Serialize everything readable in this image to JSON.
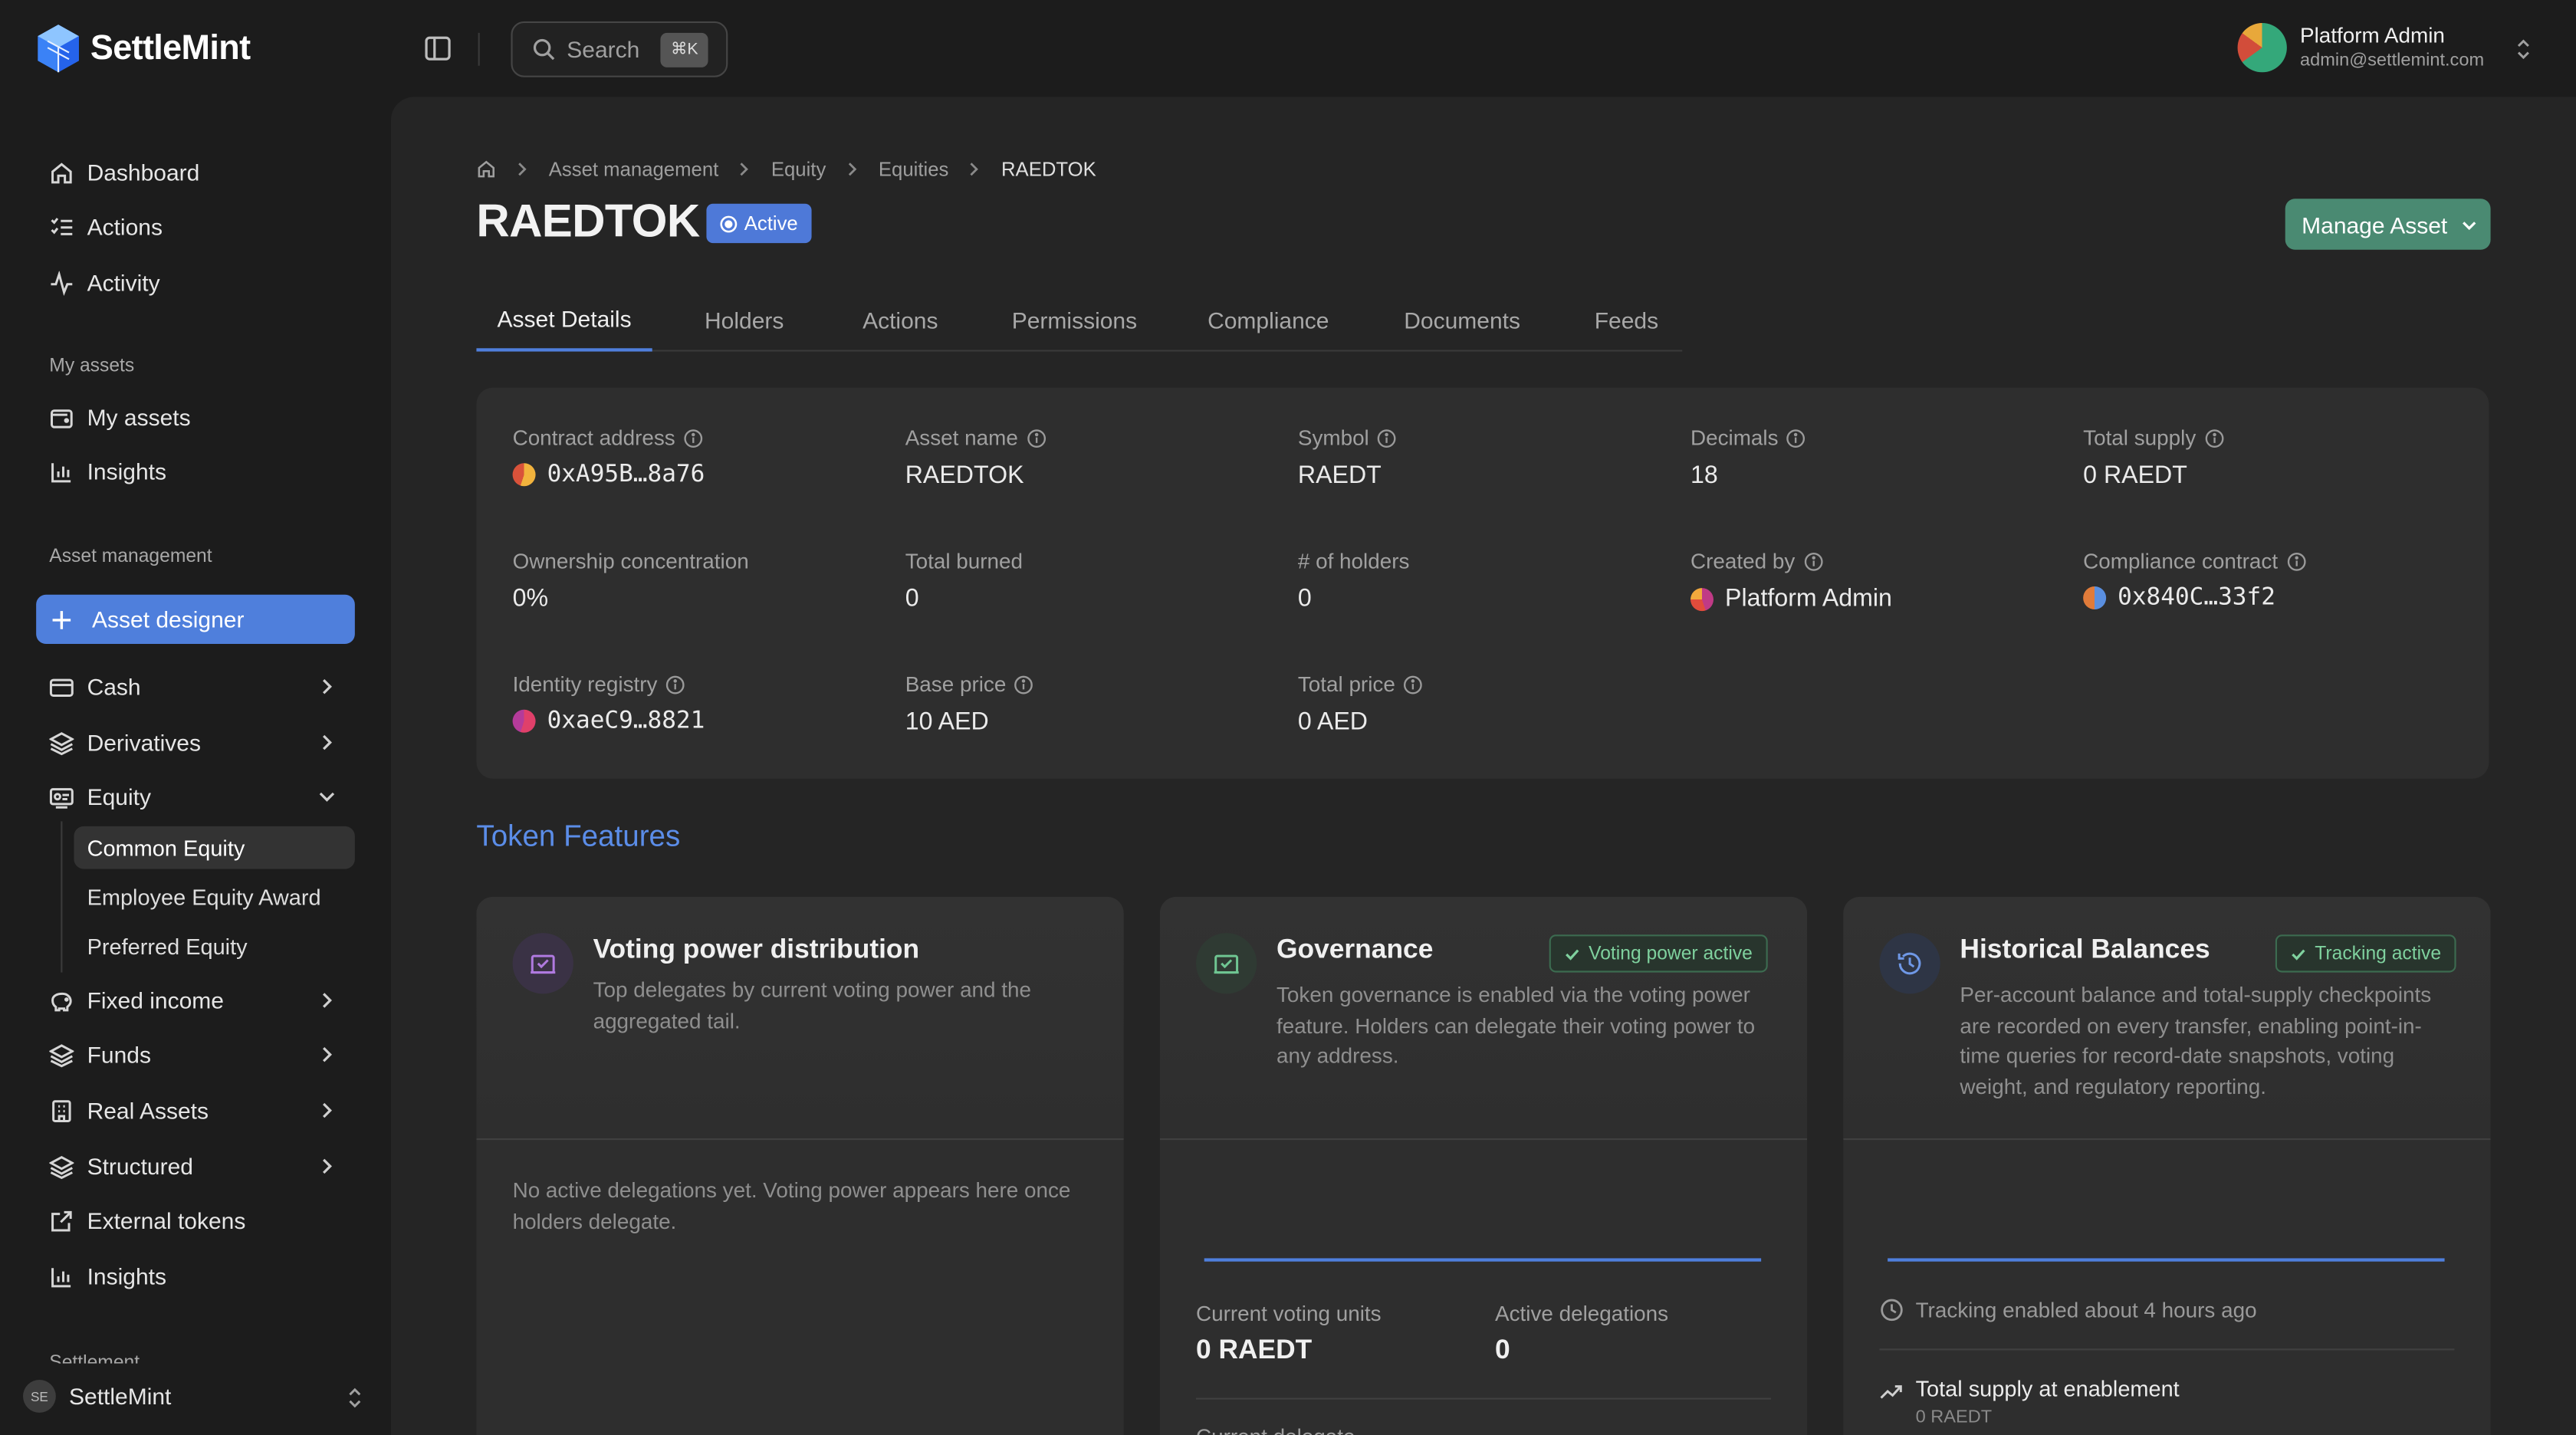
{
  "app": {
    "logo_text": "SettleMint"
  },
  "search": {
    "label": "Search",
    "shortcut": "⌘K"
  },
  "user": {
    "name": "Platform Admin",
    "email": "admin@settlemint.com"
  },
  "sidebar": {
    "main_items": [
      {
        "label": "Dashboard",
        "icon": "home-icon"
      },
      {
        "label": "Actions",
        "icon": "list-check-icon"
      },
      {
        "label": "Activity",
        "icon": "pulse-icon"
      }
    ],
    "my_assets_label": "My assets",
    "my_assets_items": [
      {
        "label": "My assets",
        "icon": "wallet-icon"
      },
      {
        "label": "Insights",
        "icon": "bar-chart-icon"
      }
    ],
    "asset_management_label": "Asset management",
    "asset_designer_label": "Asset designer",
    "asset_items": [
      {
        "label": "Cash",
        "icon": "credit-card-icon"
      },
      {
        "label": "Derivatives",
        "icon": "layers-icon"
      },
      {
        "label": "Equity",
        "icon": "equity-icon"
      }
    ],
    "equity_sub_items": [
      {
        "label": "Common Equity",
        "active": true
      },
      {
        "label": "Employee Equity Award",
        "active": false
      },
      {
        "label": "Preferred Equity",
        "active": false
      }
    ],
    "asset_items_after": [
      {
        "label": "Fixed income",
        "icon": "piggy-bank-icon"
      },
      {
        "label": "Funds",
        "icon": "layers-icon"
      },
      {
        "label": "Real Assets",
        "icon": "building-icon"
      },
      {
        "label": "Structured",
        "icon": "layers-icon"
      },
      {
        "label": "External tokens",
        "icon": "external-link-icon"
      },
      {
        "label": "Insights",
        "icon": "bar-chart-icon"
      }
    ],
    "settlement_label": "Settlement",
    "org": {
      "initials": "SE",
      "name": "SettleMint"
    }
  },
  "breadcrumb": [
    "Asset management",
    "Equity",
    "Equities",
    "RAEDTOK"
  ],
  "page": {
    "title": "RAEDTOK",
    "status": "Active",
    "manage_label": "Manage Asset"
  },
  "tabs": [
    "Asset Details",
    "Holders",
    "Actions",
    "Permissions",
    "Compliance",
    "Documents",
    "Feeds"
  ],
  "details": {
    "contract_address": {
      "label": "Contract address",
      "value": "0xA95B…8a76"
    },
    "asset_name": {
      "label": "Asset name",
      "value": "RAEDTOK"
    },
    "symbol": {
      "label": "Symbol",
      "value": "RAEDT"
    },
    "decimals": {
      "label": "Decimals",
      "value": "18"
    },
    "total_supply": {
      "label": "Total supply",
      "value": "0 RAEDT"
    },
    "ownership_concentration": {
      "label": "Ownership concentration",
      "value": "0%"
    },
    "total_burned": {
      "label": "Total burned",
      "value": "0"
    },
    "holders": {
      "label": "# of holders",
      "value": "0"
    },
    "created_by": {
      "label": "Created by",
      "value": "Platform Admin"
    },
    "compliance_contract": {
      "label": "Compliance contract",
      "value": "0x840C…33f2"
    },
    "identity_registry": {
      "label": "Identity registry",
      "value": "0xaeC9…8821"
    },
    "base_price": {
      "label": "Base price",
      "value": "10 AED"
    },
    "total_price": {
      "label": "Total price",
      "value": "0 AED"
    }
  },
  "features": {
    "title": "Token Features",
    "voting": {
      "title": "Voting power distribution",
      "desc": "Top delegates by current voting power and the aggregated tail.",
      "empty": "No active delegations yet. Voting power appears here once holders delegate."
    },
    "governance": {
      "title": "Governance",
      "badge": "Voting power active",
      "desc": "Token governance is enabled via the voting power feature. Holders can delegate their voting power to any address.",
      "current_label": "Current voting units",
      "current_value": "0 RAEDT",
      "delegations_label": "Active delegations",
      "delegations_value": "0",
      "cut_label": "Current delegate"
    },
    "historical": {
      "title": "Historical Balances",
      "badge": "Tracking active",
      "desc": "Per-account balance and total-supply checkpoints are recorded on every transfer, enabling point-in-time queries for record-date snapshots, voting weight, and regulatory reporting.",
      "tracking": "Tracking enabled about 4 hours ago",
      "supply_title": "Total supply at enablement",
      "supply_value": "0 RAEDT"
    }
  },
  "colors": {
    "accent": "#4f7fdc",
    "manage": "#4a8a72",
    "success": "#7fd19e",
    "link": "#5b8de8"
  }
}
